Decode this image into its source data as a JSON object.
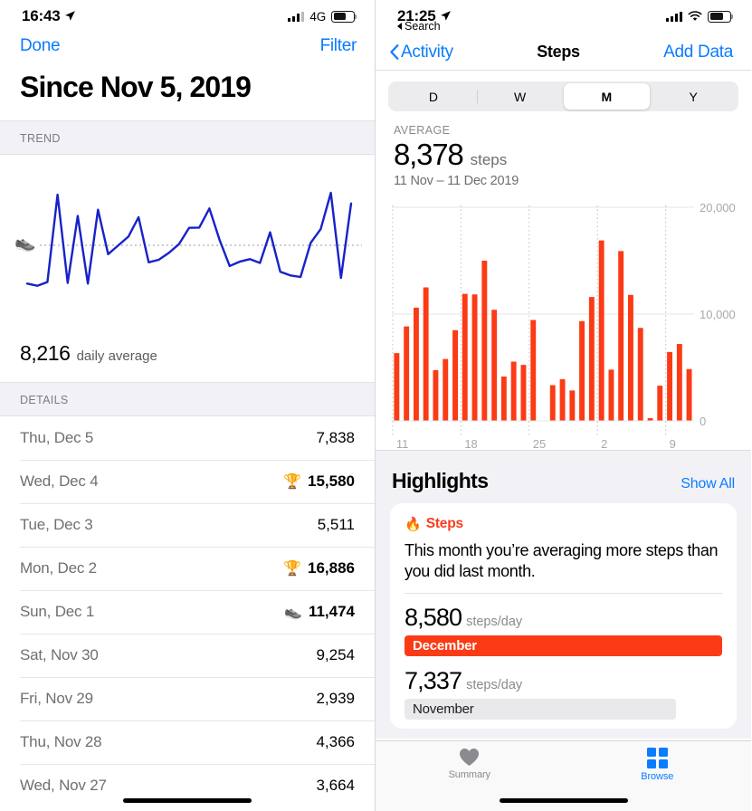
{
  "left": {
    "status": {
      "time": "16:43",
      "carrier": "4G",
      "battery_pct": 62,
      "location_icon": "location-arrow-icon"
    },
    "nav": {
      "done": "Done",
      "filter": "Filter"
    },
    "title": "Since Nov 5, 2019",
    "trend_section_label": "TREND",
    "trend_average_value": "8,216",
    "trend_average_label": "daily average",
    "details_section_label": "DETAILS",
    "details": [
      {
        "day": "Thu, Dec 5",
        "value": "7,838",
        "icon": "",
        "bold": false
      },
      {
        "day": "Wed, Dec 4",
        "value": "15,580",
        "icon": "🏆",
        "bold": true
      },
      {
        "day": "Tue, Dec 3",
        "value": "5,511",
        "icon": "",
        "bold": false
      },
      {
        "day": "Mon, Dec 2",
        "value": "16,886",
        "icon": "🏆",
        "bold": true
      },
      {
        "day": "Sun, Dec 1",
        "value": "11,474",
        "icon": "👟",
        "bold": true
      },
      {
        "day": "Sat, Nov 30",
        "value": "9,254",
        "icon": "",
        "bold": false
      },
      {
        "day": "Fri, Nov 29",
        "value": "2,939",
        "icon": "",
        "bold": false
      },
      {
        "day": "Thu, Nov 28",
        "value": "4,366",
        "icon": "",
        "bold": false
      },
      {
        "day": "Wed, Nov 27",
        "value": "3,664",
        "icon": "",
        "bold": false
      }
    ]
  },
  "right": {
    "status": {
      "time": "21:25",
      "back_app": "Search",
      "battery_pct": 68,
      "location_icon": "location-arrow-icon",
      "wifi_icon": "wifi-icon"
    },
    "nav": {
      "back": "Activity",
      "title": "Steps",
      "action": "Add Data"
    },
    "segmented": {
      "options": [
        "D",
        "W",
        "M",
        "Y"
      ],
      "selected": "M"
    },
    "average": {
      "caption": "AVERAGE",
      "value": "8,378",
      "unit": "steps",
      "range": "11 Nov – 11 Dec 2019"
    },
    "highlights": {
      "heading": "Highlights",
      "show_all": "Show All",
      "card": {
        "kind": "Steps",
        "kind_icon": "🔥",
        "text": "This month you’re averaging more steps than you did last month.",
        "current": {
          "value": "8,580",
          "unit": "steps/day",
          "label": "December"
        },
        "previous": {
          "value": "7,337",
          "unit": "steps/day",
          "label": "November"
        }
      }
    },
    "tabs": [
      {
        "label": "Summary",
        "icon": "heart-icon",
        "active": false
      },
      {
        "label": "Browse",
        "icon": "grid-icon",
        "active": true
      }
    ]
  },
  "colors": {
    "accent_blue": "#0a7cff",
    "bar_orange": "#fb3b16",
    "trend_blue": "#1722c8",
    "grid_gray": "#c9c9ce",
    "bg_gray": "#f2f2f6"
  },
  "chart_data": [
    {
      "id": "trend-line",
      "type": "line",
      "title": "TREND",
      "xlabel": "",
      "ylabel": "",
      "grid": false,
      "legend": null,
      "average_line": 8216,
      "annotation": "8,216 daily average",
      "values": [
        2100,
        1750,
        2350,
        16300,
        2200,
        12900,
        2100,
        13900,
        6800,
        8200,
        9600,
        12700,
        5500,
        5900,
        7000,
        8400,
        11000,
        11050,
        14100,
        9100,
        4900,
        5600,
        6000,
        5400,
        10300,
        4000,
        3400,
        3150,
        8600,
        10800,
        16600,
        3000,
        14900
      ]
    },
    {
      "id": "steps-bars",
      "type": "bar",
      "title": "Steps",
      "xlabel": "",
      "ylabel": "steps",
      "ylim": [
        0,
        20000
      ],
      "yticks": [
        0,
        10000,
        20000
      ],
      "yticklabels": [
        "0",
        "10,000",
        "20,000"
      ],
      "xticks": [
        "11",
        "18",
        "25",
        "2",
        "9"
      ],
      "grid": true,
      "categories": [
        "11",
        "12",
        "13",
        "14",
        "15",
        "16",
        "17",
        "18",
        "19",
        "20",
        "21",
        "22",
        "23",
        "24",
        "25",
        "26",
        "27",
        "28",
        "29",
        "30",
        "1",
        "2",
        "3",
        "4",
        "5",
        "6",
        "7",
        "8",
        "9",
        "10",
        "11"
      ],
      "values": [
        6350,
        8850,
        10600,
        12500,
        4750,
        5800,
        8500,
        11900,
        11850,
        15000,
        10400,
        4150,
        5550,
        5250,
        9450,
        0,
        3350,
        3900,
        2850,
        9350,
        11600,
        16900,
        4800,
        15900,
        11800,
        8700,
        250,
        3300,
        6450,
        7200,
        4850
      ]
    }
  ]
}
